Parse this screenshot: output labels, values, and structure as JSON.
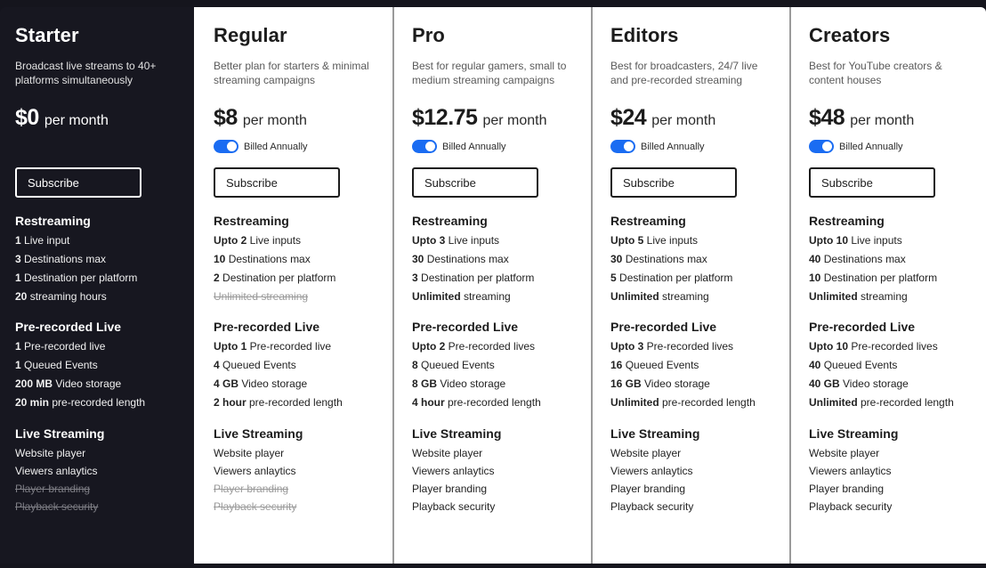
{
  "plans": [
    {
      "name": "Starter",
      "description": "Broadcast live streams to 40+ platforms simultaneously",
      "price": "$0",
      "period": "per month",
      "billing_toggle": null,
      "subscribe_label": "Subscribe",
      "restreaming": {
        "title": "Restreaming",
        "items": [
          {
            "bold": "1",
            "text": " Live input",
            "enabled": true
          },
          {
            "bold": "3",
            "text": " Destinations max",
            "enabled": true
          },
          {
            "bold": "1",
            "text": " Destination per platform",
            "enabled": true
          },
          {
            "bold": "20",
            "text": " streaming hours",
            "enabled": true
          }
        ]
      },
      "prerecorded": {
        "title": "Pre-recorded Live",
        "items": [
          {
            "bold": "1",
            "text": " Pre-recorded live",
            "enabled": true
          },
          {
            "bold": "1",
            "text": " Queued Events",
            "enabled": true
          },
          {
            "bold": "200 MB",
            "text": " Video storage",
            "enabled": true
          },
          {
            "bold": "20 min",
            "text": " pre-recorded length",
            "enabled": true
          }
        ]
      },
      "live_streaming": {
        "title": "Live Streaming",
        "items": [
          {
            "bold": "",
            "text": "Website player",
            "enabled": true
          },
          {
            "bold": "",
            "text": "Viewers anlaytics",
            "enabled": true
          },
          {
            "bold": "",
            "text": "Player branding",
            "enabled": false
          },
          {
            "bold": "",
            "text": "Playback security",
            "enabled": false
          }
        ]
      }
    },
    {
      "name": "Regular",
      "description": "Better plan for starters & minimal streaming campaigns",
      "price": "$8",
      "period": "per month",
      "billing_toggle": {
        "label": "Billed Annually",
        "on": true
      },
      "subscribe_label": "Subscribe",
      "restreaming": {
        "title": "Restreaming",
        "items": [
          {
            "bold": "Upto 2",
            "text": " Live inputs",
            "enabled": true
          },
          {
            "bold": "10",
            "text": " Destinations max",
            "enabled": true
          },
          {
            "bold": "2",
            "text": " Destination per platform",
            "enabled": true
          },
          {
            "bold": "",
            "text": "Unlimited streaming",
            "enabled": false
          }
        ]
      },
      "prerecorded": {
        "title": "Pre-recorded Live",
        "items": [
          {
            "bold": "Upto 1",
            "text": " Pre-recorded live",
            "enabled": true
          },
          {
            "bold": "4",
            "text": " Queued Events",
            "enabled": true
          },
          {
            "bold": "4 GB",
            "text": " Video storage",
            "enabled": true
          },
          {
            "bold": "2 hour",
            "text": " pre-recorded length",
            "enabled": true
          }
        ]
      },
      "live_streaming": {
        "title": "Live Streaming",
        "items": [
          {
            "bold": "",
            "text": "Website player",
            "enabled": true
          },
          {
            "bold": "",
            "text": "Viewers anlaytics",
            "enabled": true
          },
          {
            "bold": "",
            "text": "Player branding",
            "enabled": false
          },
          {
            "bold": "",
            "text": "Playback security",
            "enabled": false
          }
        ]
      }
    },
    {
      "name": "Pro",
      "description": "Best for regular gamers, small to medium streaming campaigns",
      "price": "$12.75",
      "period": "per month",
      "billing_toggle": {
        "label": "Billed Annually",
        "on": true
      },
      "subscribe_label": "Subscribe",
      "restreaming": {
        "title": "Restreaming",
        "items": [
          {
            "bold": "Upto 3",
            "text": " Live inputs",
            "enabled": true
          },
          {
            "bold": "30",
            "text": " Destinations max",
            "enabled": true
          },
          {
            "bold": "3",
            "text": " Destination per platform",
            "enabled": true
          },
          {
            "bold": "Unlimited",
            "text": " streaming",
            "enabled": true
          }
        ]
      },
      "prerecorded": {
        "title": "Pre-recorded Live",
        "items": [
          {
            "bold": "Upto 2",
            "text": " Pre-recorded lives",
            "enabled": true
          },
          {
            "bold": "8",
            "text": " Queued Events",
            "enabled": true
          },
          {
            "bold": "8 GB",
            "text": " Video storage",
            "enabled": true
          },
          {
            "bold": "4 hour",
            "text": " pre-recorded length",
            "enabled": true
          }
        ]
      },
      "live_streaming": {
        "title": "Live Streaming",
        "items": [
          {
            "bold": "",
            "text": "Website player",
            "enabled": true
          },
          {
            "bold": "",
            "text": "Viewers anlaytics",
            "enabled": true
          },
          {
            "bold": "",
            "text": "Player branding",
            "enabled": true
          },
          {
            "bold": "",
            "text": "Playback security",
            "enabled": true
          }
        ]
      }
    },
    {
      "name": "Editors",
      "description": "Best for broadcasters, 24/7 live and pre-recorded streaming",
      "price": "$24",
      "period": "per month",
      "billing_toggle": {
        "label": "Billed Annually",
        "on": true
      },
      "subscribe_label": "Subscribe",
      "restreaming": {
        "title": "Restreaming",
        "items": [
          {
            "bold": "Upto 5",
            "text": " Live inputs",
            "enabled": true
          },
          {
            "bold": "30",
            "text": " Destinations max",
            "enabled": true
          },
          {
            "bold": "5",
            "text": " Destination per platform",
            "enabled": true
          },
          {
            "bold": "Unlimited",
            "text": " streaming",
            "enabled": true
          }
        ]
      },
      "prerecorded": {
        "title": "Pre-recorded Live",
        "items": [
          {
            "bold": "Upto 3",
            "text": " Pre-recorded lives",
            "enabled": true
          },
          {
            "bold": "16",
            "text": " Queued Events",
            "enabled": true
          },
          {
            "bold": "16 GB",
            "text": " Video storage",
            "enabled": true
          },
          {
            "bold": "Unlimited",
            "text": " pre-recorded length",
            "enabled": true
          }
        ]
      },
      "live_streaming": {
        "title": "Live Streaming",
        "items": [
          {
            "bold": "",
            "text": "Website player",
            "enabled": true
          },
          {
            "bold": "",
            "text": "Viewers anlaytics",
            "enabled": true
          },
          {
            "bold": "",
            "text": "Player branding",
            "enabled": true
          },
          {
            "bold": "",
            "text": "Playback security",
            "enabled": true
          }
        ]
      }
    },
    {
      "name": "Creators",
      "description": "Best for YouTube creators & content houses",
      "price": "$48",
      "period": "per month",
      "billing_toggle": {
        "label": "Billed Annually",
        "on": true
      },
      "subscribe_label": "Subscribe",
      "restreaming": {
        "title": "Restreaming",
        "items": [
          {
            "bold": "Upto 10",
            "text": " Live inputs",
            "enabled": true
          },
          {
            "bold": "40",
            "text": " Destinations max",
            "enabled": true
          },
          {
            "bold": "10",
            "text": " Destination per platform",
            "enabled": true
          },
          {
            "bold": "Unlimited",
            "text": " streaming",
            "enabled": true
          }
        ]
      },
      "prerecorded": {
        "title": "Pre-recorded Live",
        "items": [
          {
            "bold": "Upto 10",
            "text": " Pre-recorded lives",
            "enabled": true
          },
          {
            "bold": "40",
            "text": " Queued Events",
            "enabled": true
          },
          {
            "bold": "40 GB",
            "text": " Video storage",
            "enabled": true
          },
          {
            "bold": "Unlimited",
            "text": " pre-recorded length",
            "enabled": true
          }
        ]
      },
      "live_streaming": {
        "title": "Live Streaming",
        "items": [
          {
            "bold": "",
            "text": "Website player",
            "enabled": true
          },
          {
            "bold": "",
            "text": "Viewers anlaytics",
            "enabled": true
          },
          {
            "bold": "",
            "text": "Player branding",
            "enabled": true
          },
          {
            "bold": "",
            "text": "Playback security",
            "enabled": true
          }
        ]
      }
    }
  ],
  "colors": {
    "dark_bg": "#171720",
    "toggle_on": "#1a6cf2",
    "divider": "#9a9a9a",
    "disabled_text": "#9a9a9a"
  }
}
